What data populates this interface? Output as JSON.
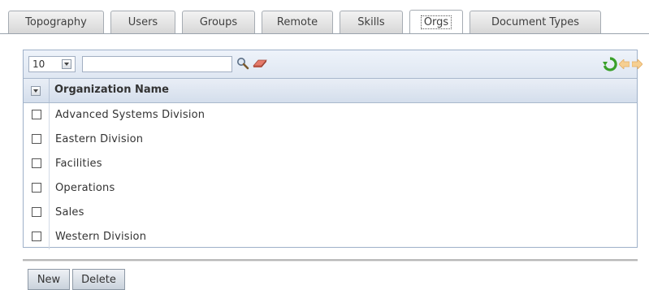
{
  "tabs": [
    {
      "label": "Topography",
      "active": false
    },
    {
      "label": "Users",
      "active": false
    },
    {
      "label": "Groups",
      "active": false
    },
    {
      "label": "Remote",
      "active": false
    },
    {
      "label": "Skills",
      "active": false
    },
    {
      "label": "Orgs",
      "active": true
    },
    {
      "label": "Document Types",
      "active": false
    }
  ],
  "toolbar": {
    "page_size": "10",
    "search_value": "",
    "icons": [
      "search-icon",
      "clear-icon",
      "refresh-icon",
      "prev-page-icon",
      "next-page-icon"
    ]
  },
  "grid": {
    "column_header": "Organization Name",
    "rows": [
      {
        "name": "Advanced Systems Division",
        "checked": false
      },
      {
        "name": "Eastern Division",
        "checked": false
      },
      {
        "name": "Facilities",
        "checked": false
      },
      {
        "name": "Operations",
        "checked": false
      },
      {
        "name": "Sales",
        "checked": false
      },
      {
        "name": "Western Division",
        "checked": false
      }
    ]
  },
  "actions": {
    "new_label": "New",
    "delete_label": "Delete"
  },
  "colors": {
    "accent_green": "#3aa02a",
    "disabled_arrow": "#f2c27b"
  }
}
